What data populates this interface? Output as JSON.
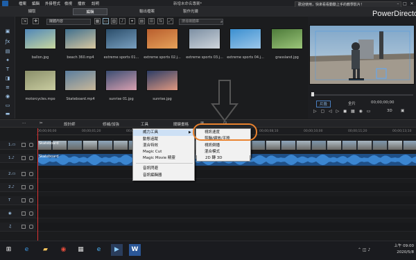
{
  "menubar": {
    "items": [
      "檔案",
      "編輯",
      "外掛程式",
      "檢視",
      "播放",
      "說明"
    ],
    "window_title": "新增未命名專案*"
  },
  "notice": "歡迎使用，快來看看動動上手的教學影片！",
  "brand": "PowerDirector",
  "tabs": [
    "擷取",
    "編輯",
    "輸出檔案",
    "製作光碟"
  ],
  "library": {
    "filter_label": "媒體內容",
    "search_placeholder": "搜尋媒體庫",
    "items": [
      {
        "name": "ballon.jpg",
        "tone": "#4f86b8",
        "tone2": "#c9d8a0"
      },
      {
        "name": "beach 360.mp4",
        "tone": "#3f6f8e",
        "tone2": "#d9c8a0"
      },
      {
        "name": "extreme sports 01...",
        "tone": "#2a4d6a",
        "tone2": "#7aa0c0"
      },
      {
        "name": "extreme sports 02.j...",
        "tone": "#b85e2e",
        "tone2": "#e6a25a"
      },
      {
        "name": "extreme sports 03.j...",
        "tone": "#7c8fa3",
        "tone2": "#d0d6dc"
      },
      {
        "name": "extreme sports 04.j...",
        "tone": "#3b8fd0",
        "tone2": "#9cc7ea"
      },
      {
        "name": "grassland.jpg",
        "tone": "#4d7a3a",
        "tone2": "#9cc67a"
      },
      {
        "name": "motorcycles.mpo",
        "tone": "#8a8f6a",
        "tone2": "#c9cca0"
      },
      {
        "name": "Skateboard.mp4",
        "tone": "#5a7d9e",
        "tone2": "#c9b89a"
      },
      {
        "name": "sunrise 01.jpg",
        "tone": "#3a4d72",
        "tone2": "#d9a0b0"
      },
      {
        "name": "sunrise.jpg",
        "tone": "#2c3d66",
        "tone2": "#e09880"
      }
    ]
  },
  "preview": {
    "mode_clip": "片段",
    "mode_movie": "全片",
    "timecode_top": "00;00;00;00",
    "timecode_bottom": "00;00;00;00",
    "label_3d": "3D"
  },
  "timeline_toolbar": {
    "settings": "設計師",
    "edit": "修補/加強",
    "tools": "工具",
    "keyframe": "關鍵畫格"
  },
  "ruler": [
    "00;00;00;00",
    "00;00;01;20",
    "00;00;03;10",
    "00;00;05;00",
    "00;00;06;20",
    "00;00;08;10",
    "00;00;10;00",
    "00;00;11;20",
    "00;00;13;10"
  ],
  "tracks": [
    "1.",
    "1.",
    "2.",
    "2.",
    "",
    "",
    ""
  ],
  "clip_video_label": "Skateboard",
  "clip_audio_label": "Skateboard",
  "context_menu": {
    "items": [
      "威力工具",
      "動態追蹤",
      "混合特效",
      "Magic Cut",
      "Magic Movie 精靈",
      "音訊閃避",
      "音訊編輯器"
    ]
  },
  "submenu": {
    "items": [
      "視訊速度",
      "剪輯/縮放/平移",
      "視訊倒播",
      "混合模式",
      "2D 轉 3D"
    ]
  },
  "taskbar": {
    "time": "上午 09:00",
    "date": "2020/5/8"
  }
}
